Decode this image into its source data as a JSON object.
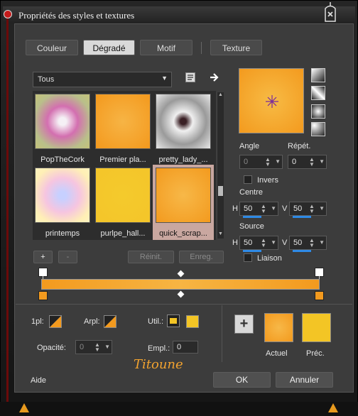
{
  "window": {
    "title": "Propriétés des styles et textures"
  },
  "tabs": [
    {
      "label": "Couleur",
      "active": false
    },
    {
      "label": "Dégradé",
      "active": true
    },
    {
      "label": "Motif",
      "active": false
    },
    {
      "label": "Texture",
      "active": false
    }
  ],
  "category": {
    "value": "Tous"
  },
  "gallery": {
    "items": [
      {
        "label": "PopTheCork",
        "style": "radial-gradient(circle,#f5f0f5 10%,#d36fb0 40%,#b9c08a 75%,#c5c27a 100%)"
      },
      {
        "label": "Premier pla...",
        "style": "radial-gradient(circle,#f6b445,#f4991d)"
      },
      {
        "label": "pretty_lady_...",
        "style": "radial-gradient(circle,#3a2025 8%,#f0f0f0 25%,#9a9a9a 60%,#e8e8e8 100%)"
      },
      {
        "label": "printemps",
        "style": "radial-gradient(circle,#c7d0ff 10%,#f6c5e0 45%,#fff0b5 80%,#fff2c0 100%)"
      },
      {
        "label": "purlpe_hall...",
        "style": "radial-gradient(circle,#f4ca2c,#f4c52a)"
      },
      {
        "label": "quick_scrap...",
        "style": "radial-gradient(circle,#f7b848,#f39a1e)"
      }
    ]
  },
  "gallery_buttons": {
    "add": "+",
    "remove": "-",
    "reset": "Réinit.",
    "save": "Enreg."
  },
  "params": {
    "angle_label": "Angle",
    "angle_value": "0",
    "repeat_label": "Répét.",
    "repeat_value": "0",
    "invert_label": "Invers",
    "center_label": "Centre",
    "center_h_label": "H",
    "center_h": "50",
    "center_v_label": "V",
    "center_v": "50",
    "source_label": "Source",
    "source_h_label": "H",
    "source_h": "50",
    "source_v_label": "V",
    "source_v": "50",
    "link_label": "Liaison"
  },
  "stops": {
    "first_label": "1pl:",
    "back_label": "Arpl:",
    "user_label": "Util.:",
    "opacity_label": "Opacité:",
    "opacity_value": "0",
    "location_label": "Empl.:",
    "location_value": "0"
  },
  "swatches": {
    "current_label": "Actuel",
    "previous_label": "Préc.",
    "current_color": "#f39a1e",
    "previous_color": "#f3c525"
  },
  "signature": "Titoune",
  "footer": {
    "help": "Aide",
    "ok": "OK",
    "cancel": "Annuler"
  },
  "colors": {
    "accent_orange": "#f39a1e",
    "accent_yellow": "#f3c525",
    "focus_blue": "#2e8ae6"
  }
}
